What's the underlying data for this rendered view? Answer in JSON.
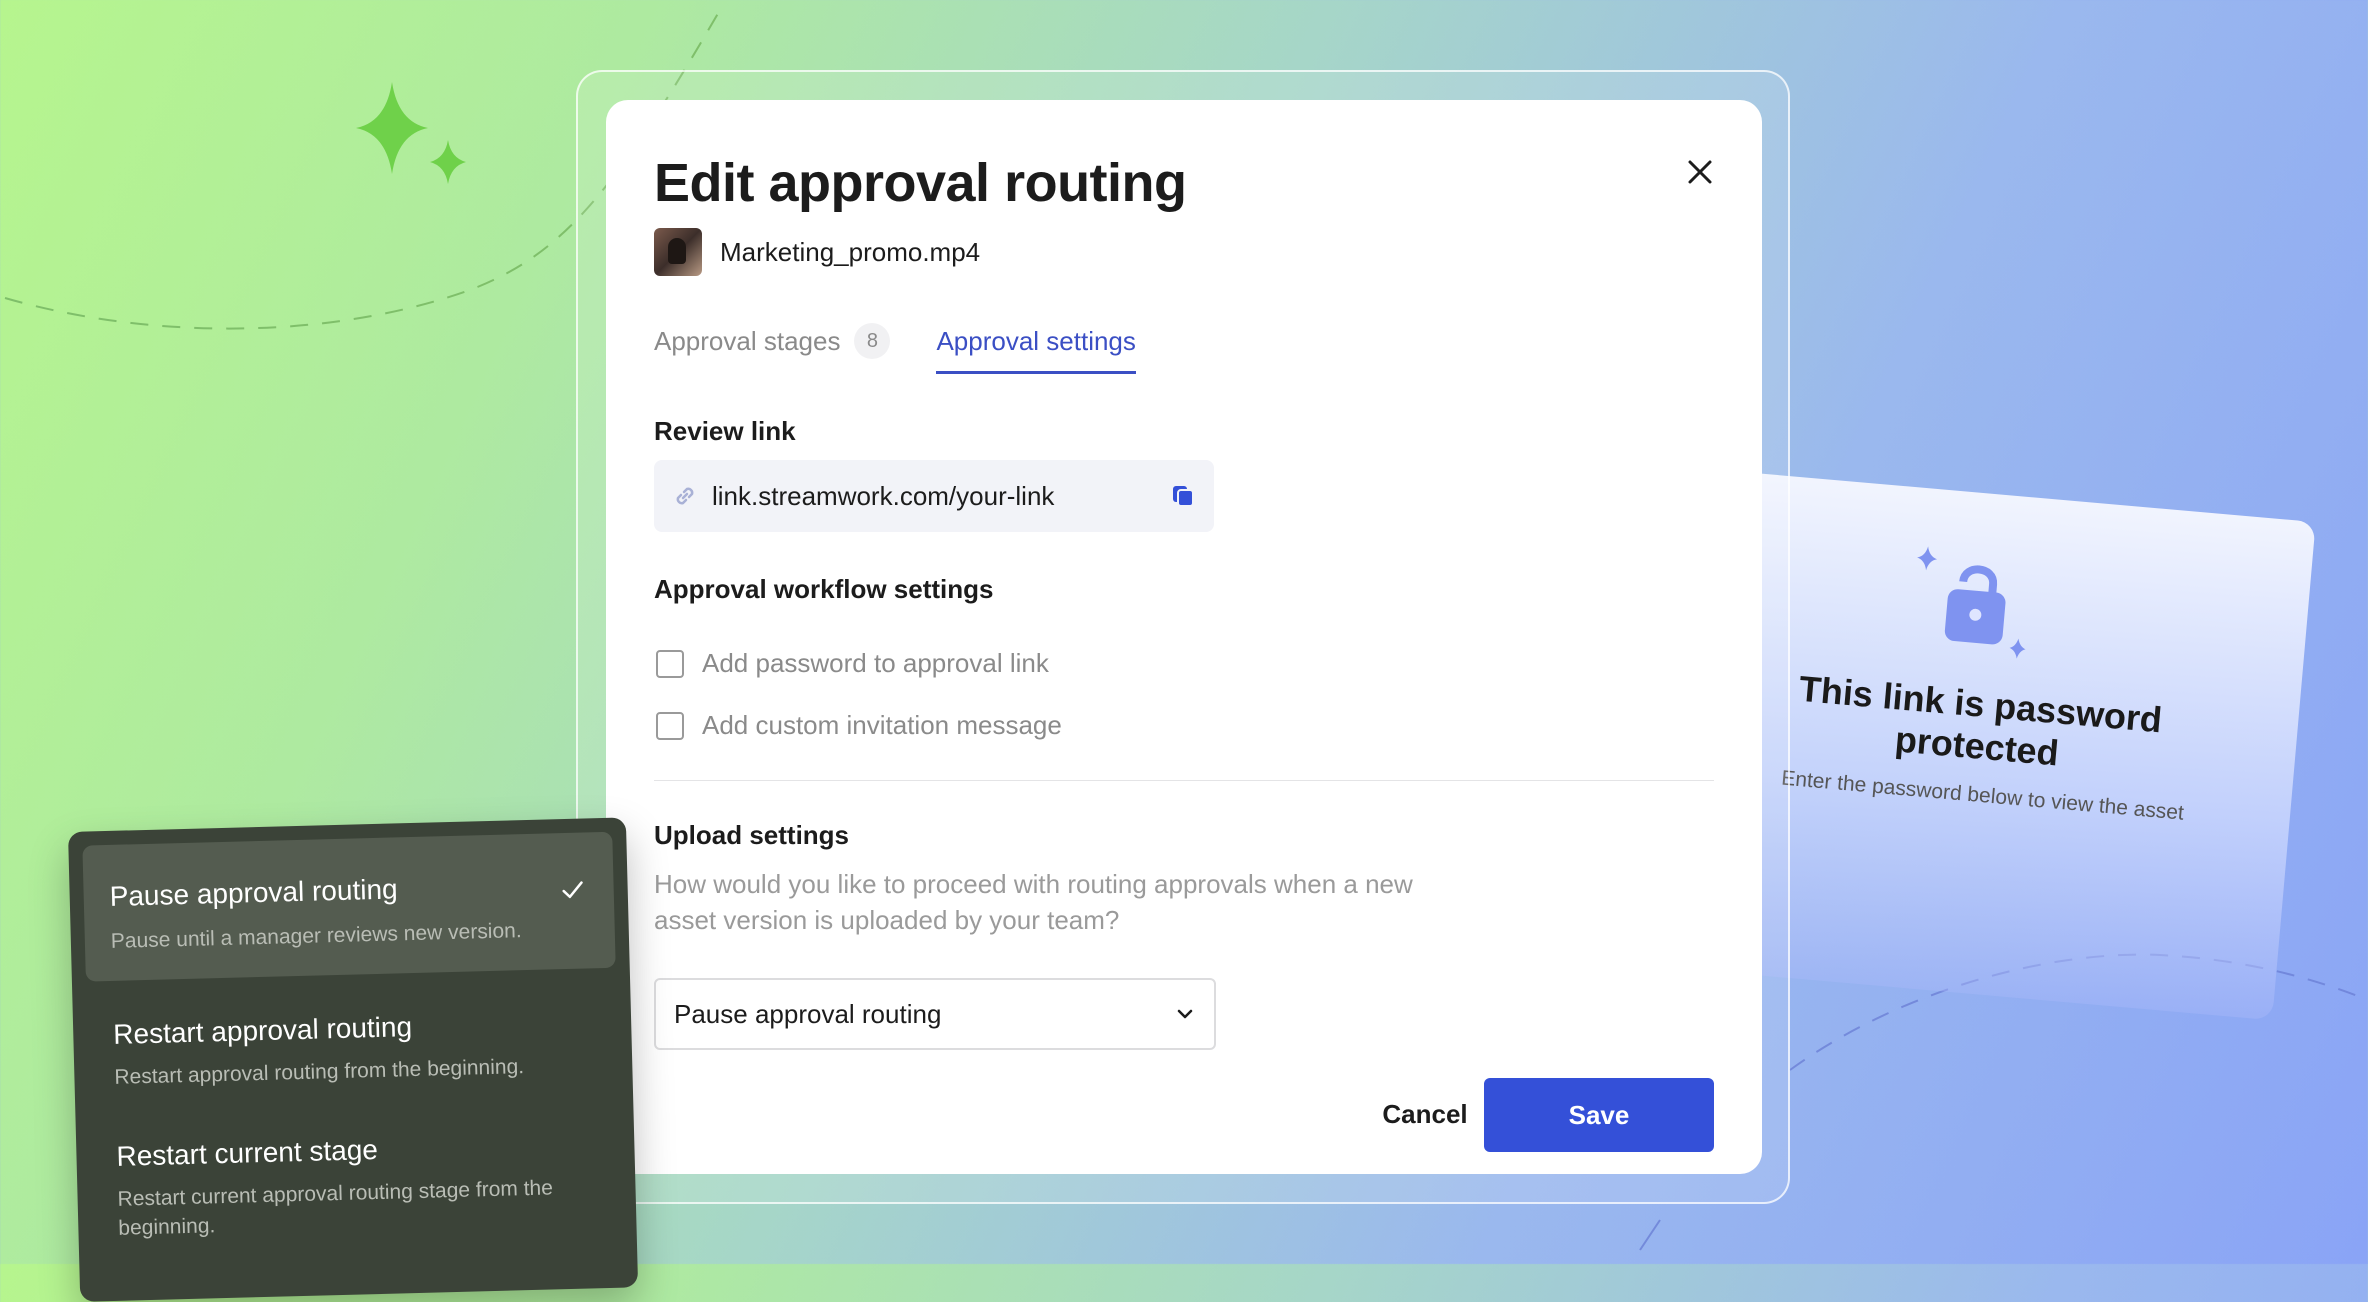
{
  "modal": {
    "title": "Edit approval routing",
    "asset_name": "Marketing_promo.mp4",
    "tabs": [
      {
        "label": "Approval stages",
        "badge": "8"
      },
      {
        "label": "Approval settings"
      }
    ],
    "review_link": {
      "label": "Review link",
      "value": "link.streamwork.com/your-link"
    },
    "workflow": {
      "label": "Approval workflow settings",
      "options": [
        {
          "label": "Add password to approval link",
          "checked": false
        },
        {
          "label": "Add custom invitation message",
          "checked": false
        }
      ]
    },
    "upload": {
      "label": "Upload settings",
      "help": "How would you like to proceed with routing approvals when a new asset version is uploaded by your team?",
      "selected": "Pause approval routing"
    },
    "actions": {
      "cancel": "Cancel",
      "save": "Save"
    }
  },
  "dropdown_menu": {
    "items": [
      {
        "title": "Pause approval routing",
        "desc": "Pause until a manager reviews new version.",
        "selected": true
      },
      {
        "title": "Restart approval routing",
        "desc": "Restart approval routing from the beginning.",
        "selected": false
      },
      {
        "title": "Restart current stage",
        "desc": "Restart current approval routing stage from the beginning.",
        "selected": false
      }
    ]
  },
  "password_card": {
    "title": "This link is password protected",
    "subtitle": "Enter the password below to view the asset"
  },
  "colors": {
    "accent": "#3450d8",
    "tab_active": "#3b4fc4",
    "menu_bg": "#3b4338",
    "sparkle": "#6fd14a",
    "lock": "#7f93f0"
  },
  "icons": [
    "close-icon",
    "link-icon",
    "copy-icon",
    "chevron-down-icon",
    "check-icon",
    "lock-icon",
    "sparkle-icon"
  ]
}
